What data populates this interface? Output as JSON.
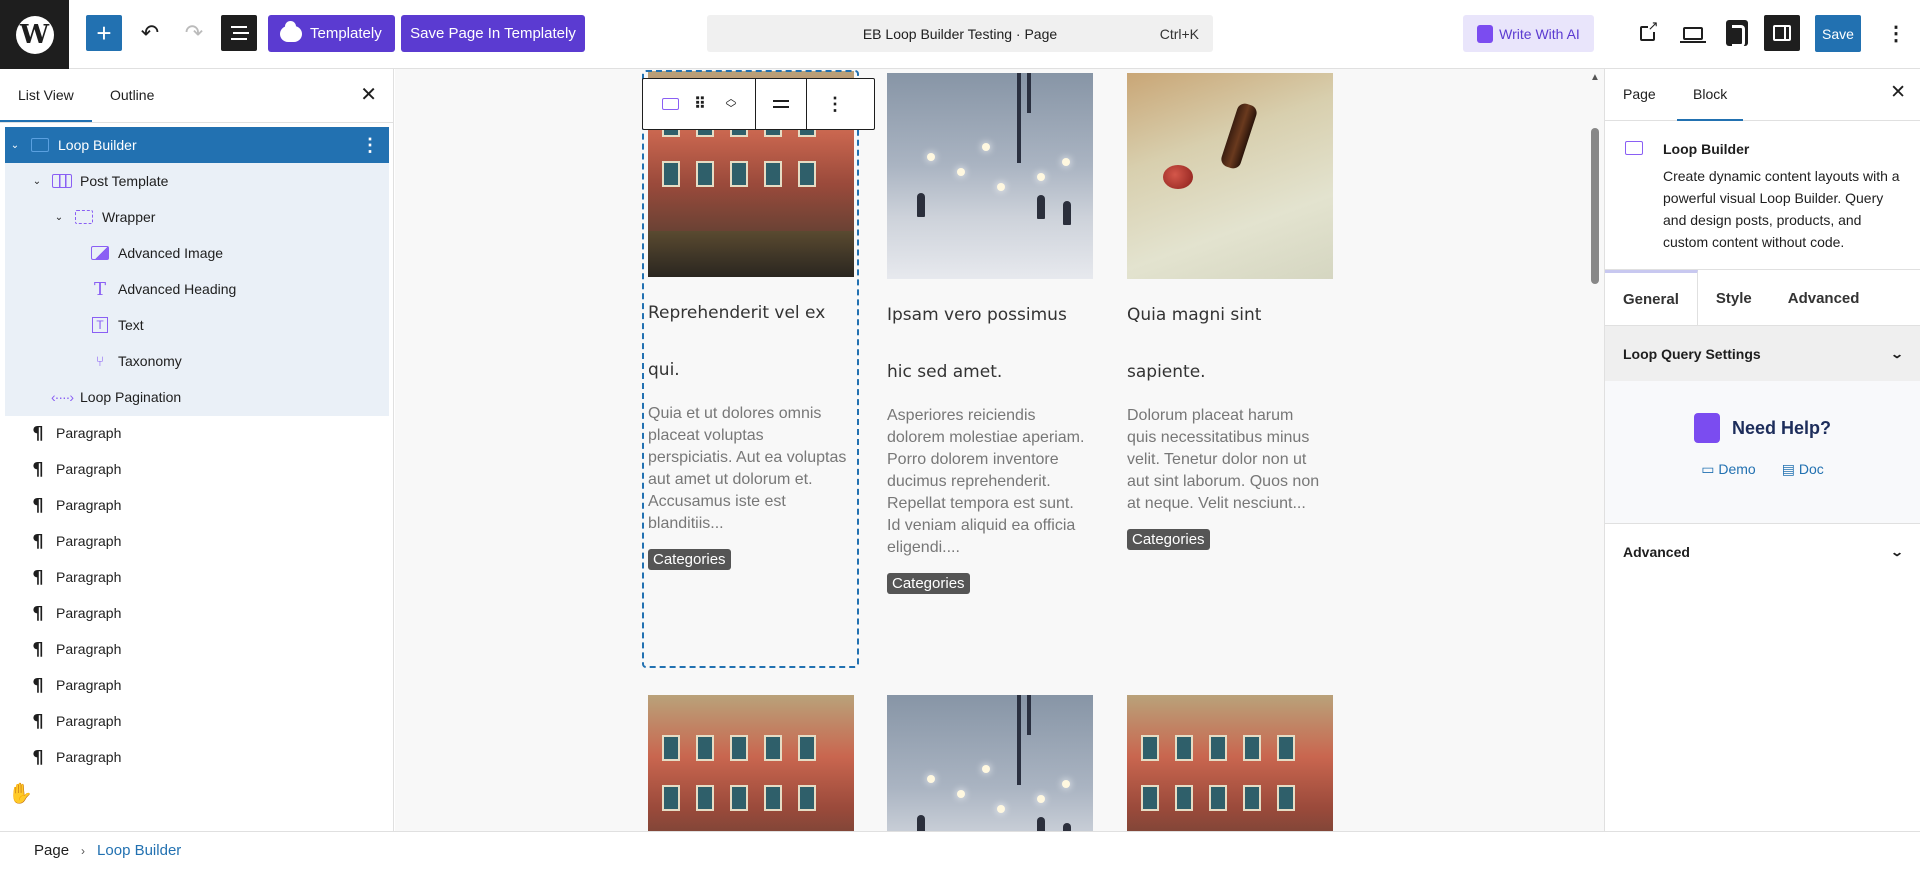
{
  "topbar": {
    "templately_label": "Templately",
    "save_templately_label": "Save Page In Templately",
    "command_title": "EB Loop Builder Testing · Page",
    "command_shortcut": "Ctrl+K",
    "ai_label": "Write With AI",
    "save_label": "Save"
  },
  "left_panel": {
    "tabs": [
      "List View",
      "Outline"
    ],
    "tree": [
      {
        "label": "Loop Builder",
        "level": 0,
        "icon": "loop-builder-icon",
        "selected": true
      },
      {
        "label": "Post Template",
        "level": 1,
        "icon": "post-template-icon"
      },
      {
        "label": "Wrapper",
        "level": 2,
        "icon": "wrapper-icon"
      },
      {
        "label": "Advanced Image",
        "level": 3,
        "icon": "image-icon"
      },
      {
        "label": "Advanced Heading",
        "level": 3,
        "icon": "heading-icon"
      },
      {
        "label": "Text",
        "level": 3,
        "icon": "text-icon"
      },
      {
        "label": "Taxonomy",
        "level": 3,
        "icon": "taxonomy-icon"
      },
      {
        "label": "Loop Pagination",
        "level": 1,
        "icon": "pagination-icon"
      },
      {
        "label": "Paragraph",
        "level": -1,
        "icon": "paragraph-icon"
      },
      {
        "label": "Paragraph",
        "level": -1,
        "icon": "paragraph-icon"
      },
      {
        "label": "Paragraph",
        "level": -1,
        "icon": "paragraph-icon"
      },
      {
        "label": "Paragraph",
        "level": -1,
        "icon": "paragraph-icon"
      },
      {
        "label": "Paragraph",
        "level": -1,
        "icon": "paragraph-icon"
      },
      {
        "label": "Paragraph",
        "level": -1,
        "icon": "paragraph-icon"
      },
      {
        "label": "Paragraph",
        "level": -1,
        "icon": "paragraph-icon"
      },
      {
        "label": "Paragraph",
        "level": -1,
        "icon": "paragraph-icon"
      },
      {
        "label": "Paragraph",
        "level": -1,
        "icon": "paragraph-icon"
      },
      {
        "label": "Paragraph",
        "level": -1,
        "icon": "paragraph-icon"
      }
    ]
  },
  "breadcrumb": {
    "root": "Page",
    "current": "Loop Builder"
  },
  "posts": [
    {
      "heading_line1": "Reprehenderit vel ex",
      "heading_line2": "qui.",
      "excerpt": "Quia et ut dolores omnis placeat voluptas perspiciatis. Aut ea voluptas aut amet ut dolorum et. Accusamus iste est blanditiis...",
      "category": "Categories",
      "image": "building"
    },
    {
      "heading_line1": "Ipsam vero possimus",
      "heading_line2": "hic sed amet.",
      "excerpt": "Asperiores reiciendis dolorem molestiae aperiam. Porro dolorem inventore ducimus reprehenderit. Repellat tempora est sunt. Id veniam aliquid ea officia eligendi....",
      "category": "Categories",
      "image": "snow"
    },
    {
      "heading_line1": "Quia magni sint",
      "heading_line2": "sapiente.",
      "excerpt": "Dolorum placeat harum quis necessitatibus minus velit. Tenetur dolor non ut aut sint laborum. Quos non at neque. Velit nesciunt...",
      "category": "Categories",
      "image": "seal"
    }
  ],
  "right_panel": {
    "tabs": [
      "Page",
      "Block"
    ],
    "block_name": "Loop Builder",
    "block_desc": "Create dynamic content layouts with a powerful visual Loop Builder. Query and design posts, products, and custom content without code.",
    "eb_tabs": [
      "General",
      "Style",
      "Advanced"
    ],
    "loop_query_label": "Loop Query Settings",
    "help_title": "Need Help?",
    "demo_label": "Demo",
    "doc_label": "Doc",
    "advanced_label": "Advanced"
  },
  "colors": {
    "accent": "#2271b1",
    "templately": "#5b3bd1",
    "eb_purple": "#7b4cf0"
  }
}
